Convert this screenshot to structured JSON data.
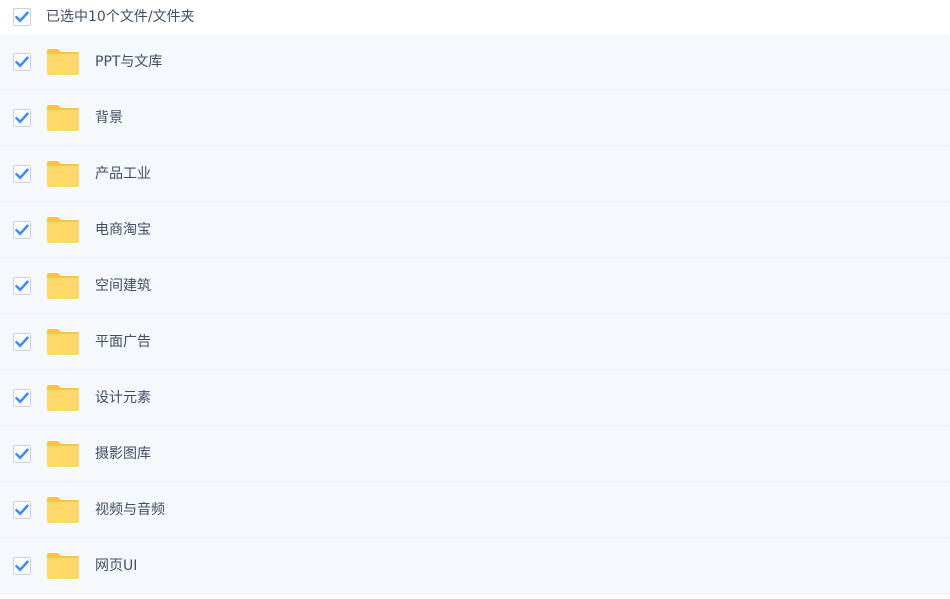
{
  "selection_bar": {
    "checked": true,
    "label": "已选中10个文件/文件夹"
  },
  "colors": {
    "check_accent": "#3b8cff",
    "folder_body": "#ffd86a",
    "folder_tab": "#f7c548",
    "row_background": "#f5f9fd",
    "text": "#424e67"
  },
  "icons": {
    "checkbox": "checkmark-icon",
    "folder": "folder-icon"
  },
  "files": [
    {
      "name": "PPT与文库",
      "checked": true,
      "type": "folder"
    },
    {
      "name": "背景",
      "checked": true,
      "type": "folder"
    },
    {
      "name": "产品工业",
      "checked": true,
      "type": "folder"
    },
    {
      "name": "电商淘宝",
      "checked": true,
      "type": "folder"
    },
    {
      "name": "空间建筑",
      "checked": true,
      "type": "folder"
    },
    {
      "name": "平面广告",
      "checked": true,
      "type": "folder"
    },
    {
      "name": "设计元素",
      "checked": true,
      "type": "folder"
    },
    {
      "name": "摄影图库",
      "checked": true,
      "type": "folder"
    },
    {
      "name": "视频与音频",
      "checked": true,
      "type": "folder"
    },
    {
      "name": "网页UI",
      "checked": true,
      "type": "folder"
    }
  ]
}
